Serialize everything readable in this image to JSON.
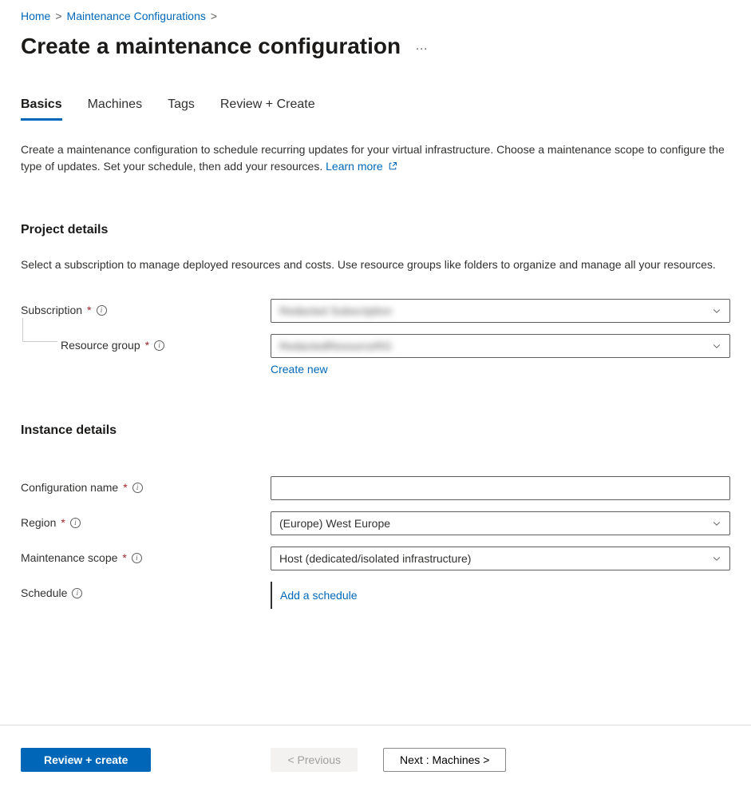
{
  "breadcrumb": {
    "home": "Home",
    "item2": "Maintenance Configurations"
  },
  "page": {
    "title": "Create a maintenance configuration",
    "more": "…"
  },
  "tabs": {
    "basics": "Basics",
    "machines": "Machines",
    "tags": "Tags",
    "review": "Review + Create"
  },
  "intro": {
    "text": "Create a maintenance configuration to schedule recurring updates for your virtual infrastructure. Choose a maintenance scope to configure the type of updates. Set your schedule, then add your resources. ",
    "learn_more": "Learn more"
  },
  "project": {
    "title": "Project details",
    "desc": "Select a subscription to manage deployed resources and costs. Use resource groups like folders to organize and manage all your resources.",
    "subscription_label": "Subscription",
    "subscription_value": "Redacted Subscription",
    "resource_group_label": "Resource group",
    "resource_group_value": "RedactedResourceRG",
    "create_new": "Create new"
  },
  "instance": {
    "title": "Instance details",
    "config_name_label": "Configuration name",
    "config_name_value": "",
    "region_label": "Region",
    "region_value": "(Europe) West Europe",
    "scope_label": "Maintenance scope",
    "scope_value": "Host (dedicated/isolated infrastructure)",
    "schedule_label": "Schedule",
    "add_schedule": "Add a schedule"
  },
  "footer": {
    "review_create": "Review + create",
    "previous": "< Previous",
    "next": "Next : Machines >"
  }
}
